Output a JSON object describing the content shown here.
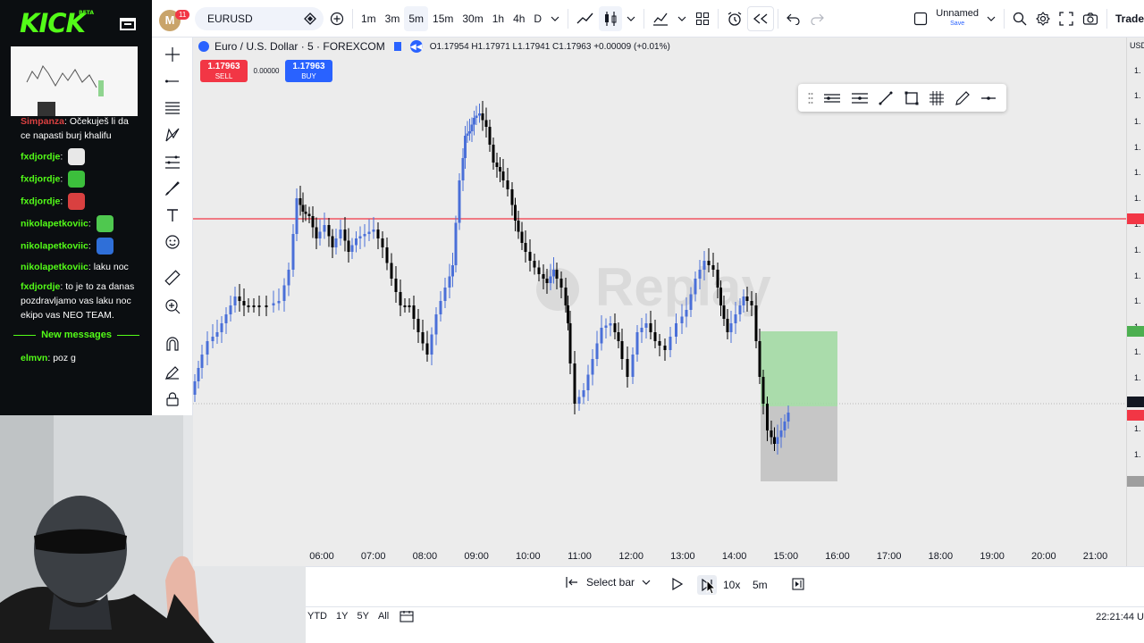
{
  "chat": {
    "logo": "KICK",
    "logo_badge": "BETA",
    "partial_user": "Simpanza",
    "partial_text": "Očekuješ li da ce napasti burj khalifu",
    "messages": [
      {
        "user": "fxdjordje",
        "text": "",
        "user_color": "#53fc18",
        "emote_color": "#e8e8e8"
      },
      {
        "user": "fxdjordje",
        "text": "",
        "user_color": "#53fc18",
        "emote_color": "#3cbf3c"
      },
      {
        "user": "fxdjordje",
        "text": "",
        "user_color": "#53fc18",
        "emote_color": "#d94040"
      },
      {
        "user": "nikolapetkoviic",
        "text": "",
        "user_color": "#53fc18",
        "emote_color": "#4fc84f"
      },
      {
        "user": "nikolapetkoviic",
        "text": "",
        "user_color": "#53fc18",
        "emote_color": "#2f6fd8"
      },
      {
        "user": "nikolapetkoviic",
        "text": "laku noc",
        "user_color": "#53fc18",
        "emote_color": ""
      },
      {
        "user": "fxdjordje",
        "text": "to je to za danas pozdravljamo vas laku noc ekipo vas NEO TEAM.",
        "user_color": "#53fc18",
        "emote_color": ""
      }
    ],
    "new_messages_label": "New messages",
    "last_message": {
      "user": "elmvn",
      "text": "poz g",
      "user_color": "#53fc18"
    }
  },
  "topbar": {
    "avatar_letter": "M",
    "notification_count": "11",
    "symbol": "EURUSD",
    "intervals": [
      "1m",
      "3m",
      "5m",
      "15m",
      "30m",
      "1h",
      "4h",
      "D"
    ],
    "active_interval": "5m",
    "layout_name": "Unnamed",
    "layout_status": "Save",
    "trade_label": "Trade"
  },
  "chart_header": {
    "title": "Euro / U.S. Dollar · 5 · FOREXCOM",
    "ohlc": "O1.17954 H1.17971 L1.17941 C1.17963 +0.00009 (+0.01%)",
    "sell_price": "1.17963",
    "sell_label": "SELL",
    "spread": "0.00000",
    "buy_price": "1.17963",
    "buy_label": "BUY",
    "watermark": "Replay",
    "currency": "USD"
  },
  "price_scale_labels": [
    "1.",
    "1.",
    "1.",
    "1.",
    "1.",
    "1.",
    "1.",
    "1.",
    "1.",
    "1.",
    "1.",
    "1.",
    "1.",
    "1.",
    "1.",
    "1.",
    "1."
  ],
  "time_axis": [
    "06:00",
    "07:00",
    "08:00",
    "09:00",
    "10:00",
    "11:00",
    "12:00",
    "13:00",
    "14:00",
    "15:00",
    "16:00",
    "17:00",
    "18:00",
    "19:00",
    "20:00",
    "21:00"
  ],
  "replay": {
    "select_bar_label": "Select bar",
    "speed": "10x",
    "interval": "5m"
  },
  "ranges": [
    "YTD",
    "1Y",
    "5Y",
    "All"
  ],
  "clock": "22:21:44 U",
  "colors": {
    "up_candle": "#4a6fd8",
    "down_candle": "#000000",
    "sell": "#f23645",
    "buy": "#2962ff",
    "horizontal_line": "#f23645",
    "tp_zone": "#9fd9a0",
    "sl_zone": "#bdbdbd",
    "kick_green": "#53fc18"
  }
}
